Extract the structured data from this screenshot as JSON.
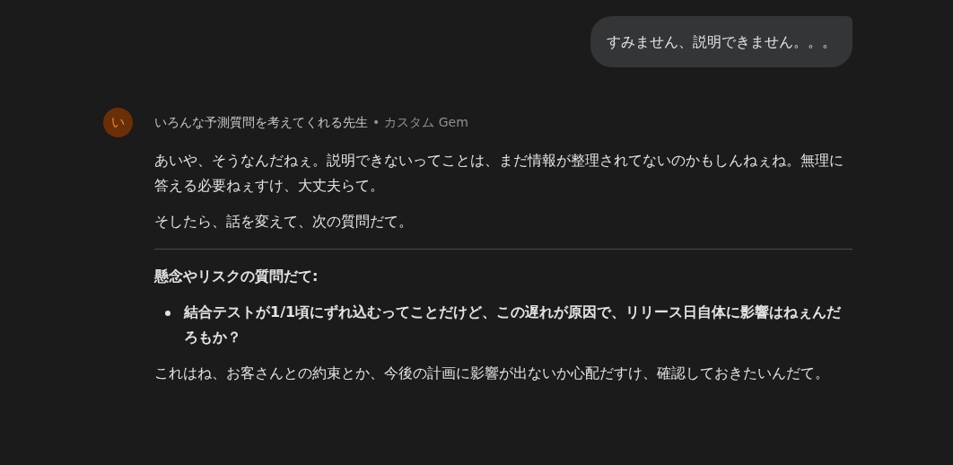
{
  "user_message": {
    "text": "すみません、説明できません。。。"
  },
  "response": {
    "avatar_letter": "い",
    "gem_name": "いろんな予測質問を考えてくれる先生",
    "separator": "•",
    "gem_type": "カスタム Gem",
    "blocks": [
      {
        "kind": "paragraph",
        "text": "あいや、そうなんだねぇ。説明できないってことは、まだ情報が整理されてないのかもしんねぇね。無理に答える必要ねぇすけ、大丈夫らて。"
      },
      {
        "kind": "paragraph",
        "text": "そしたら、話を変えて、次の質問だて。"
      },
      {
        "kind": "divider"
      },
      {
        "kind": "heading",
        "text": "懸念やリスクの質問だて:"
      },
      {
        "kind": "bullets",
        "items": [
          "結合テストが1/1頃にずれ込むってことだけど、この遅れが原因で、リリース日自体に影響はねぇんだろもか？"
        ]
      },
      {
        "kind": "paragraph",
        "text": "これはね、お客さんとの約束とか、今後の計画に影響が出ないか心配だすけ、確認しておきたいんだて。"
      }
    ]
  }
}
